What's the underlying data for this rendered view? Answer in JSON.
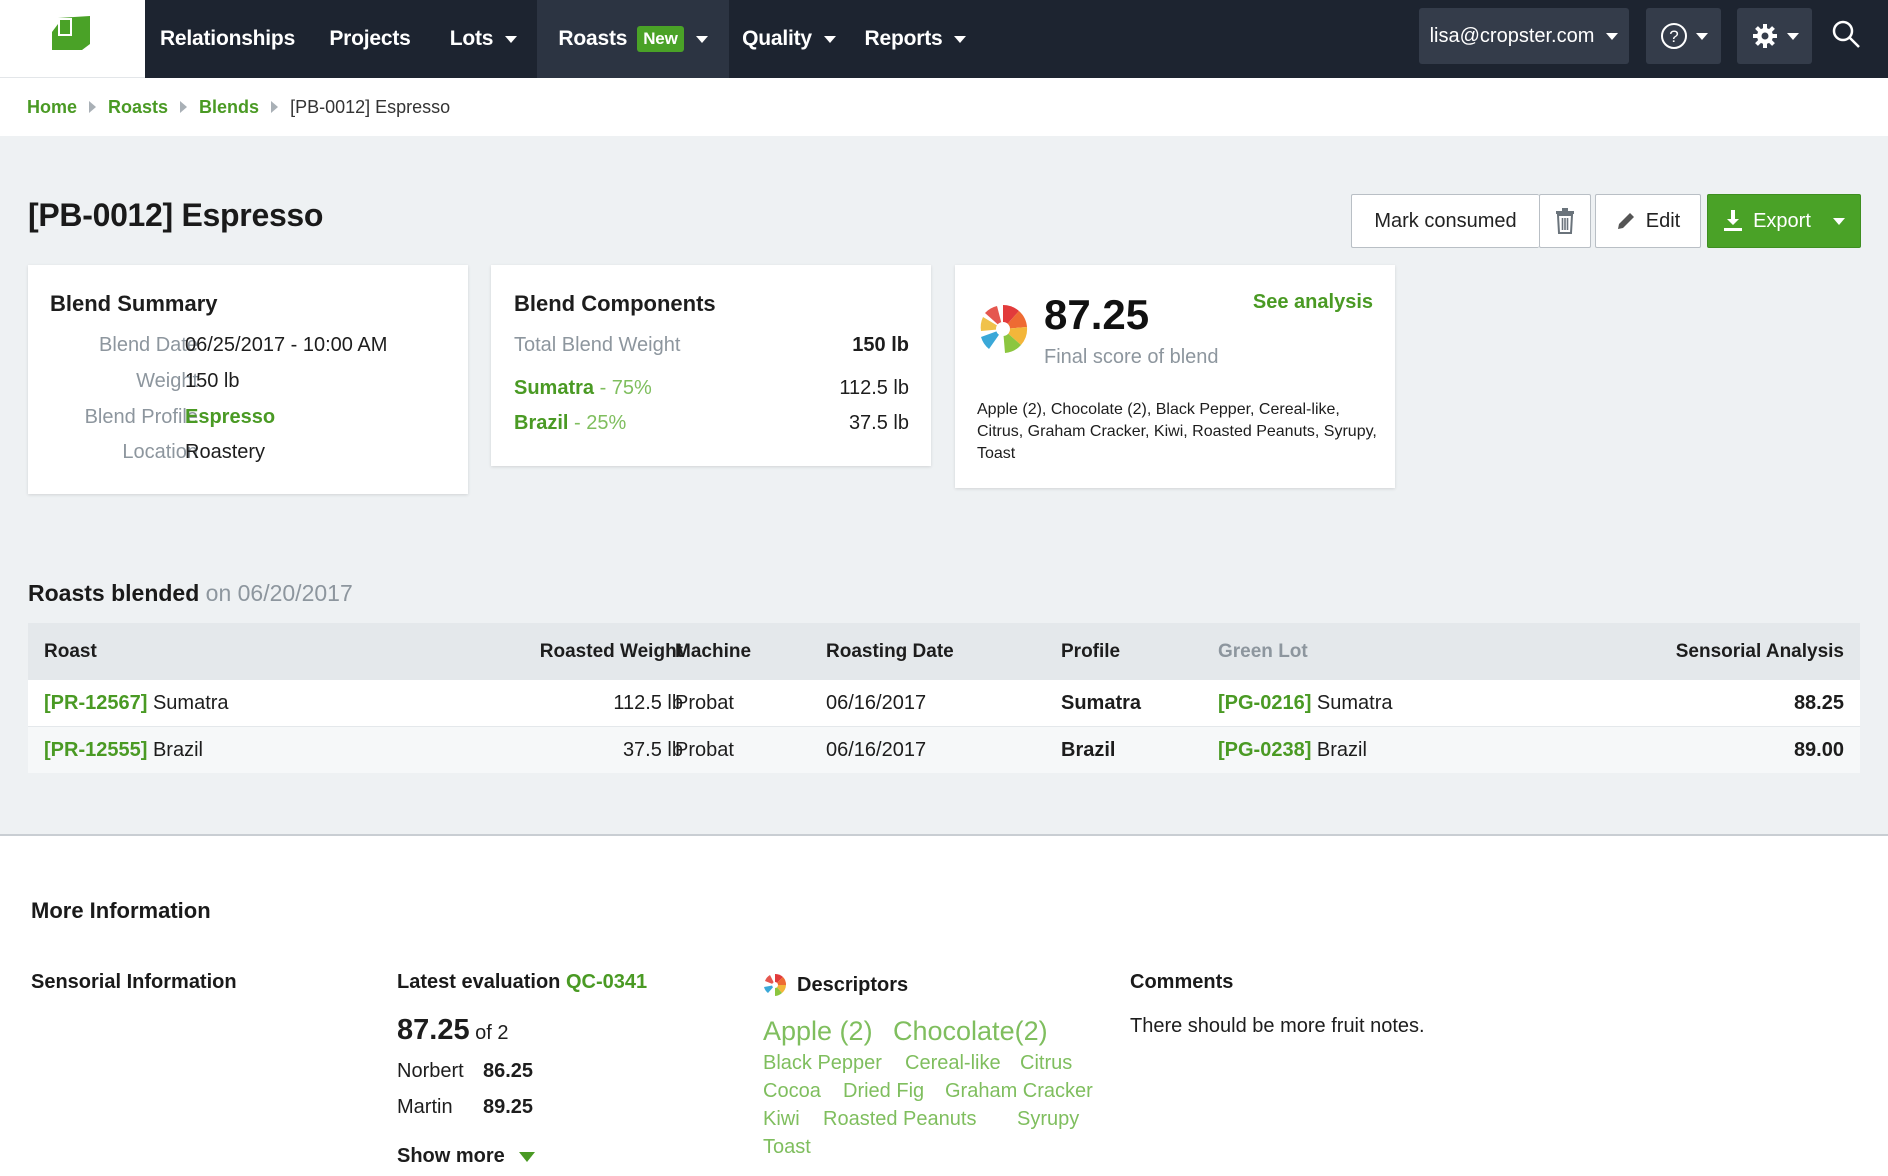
{
  "nav": {
    "items": [
      {
        "label": "Relationships"
      },
      {
        "label": "Projects"
      },
      {
        "label": "Lots"
      },
      {
        "label": "Roasts",
        "badge": "New"
      },
      {
        "label": "Quality"
      },
      {
        "label": "Reports"
      }
    ],
    "user": "lisa@cropster.com",
    "help_icon": "question-circle-icon",
    "settings_icon": "gear-icon",
    "search_icon": "search-icon",
    "brand_color": "#4aa227"
  },
  "breadcrumb": {
    "items": [
      "Home",
      "Roasts",
      "Blends"
    ],
    "current": "[PB-0012] Espresso"
  },
  "page": {
    "title": "[PB-0012] Espresso",
    "actions": {
      "mark_consumed": "Mark consumed",
      "delete_icon": "trash-icon",
      "edit": "Edit",
      "export": "Export"
    }
  },
  "blend_summary": {
    "title": "Blend Summary",
    "rows": [
      {
        "label": "Blend Date",
        "value": "06/25/2017 - 10:00 AM"
      },
      {
        "label": "Weight",
        "value": "150 lb"
      },
      {
        "label": "Blend Profile",
        "value": "Espresso"
      },
      {
        "label": "Location",
        "value": "Roastery"
      }
    ]
  },
  "blend_components": {
    "title": "Blend Components",
    "total_label": "Total Blend Weight",
    "total_value": "150 lb",
    "components": [
      {
        "name": "Sumatra",
        "pct": " - 75%",
        "weight": "112.5 lb"
      },
      {
        "name": "Brazil",
        "pct": " - 25%",
        "weight": "37.5 lb"
      }
    ]
  },
  "score_card": {
    "score": "87.25",
    "subtitle": "Final score of blend",
    "link": "See analysis",
    "descriptors": "Apple (2), Chocolate (2), Black Pepper, Cereal-like, Citrus, Graham Cracker, Kiwi, Roasted Peanuts, Syrupy, Toast"
  },
  "roasts": {
    "title": "Roasts blended",
    "date": "on 06/20/2017",
    "columns": [
      "Roast",
      "Roasted Weight",
      "Machine",
      "Roasting Date",
      "Profile",
      "Green Lot",
      "Sensorial Analysis"
    ],
    "rows": [
      {
        "roast_id": "[PR-12567]",
        "roast_name": " Sumatra",
        "weight": "112.5 lb",
        "machine": "Probat",
        "date": "06/16/2017",
        "profile": "Sumatra",
        "lot_id": "[PG-0216]",
        "lot_name": " Sumatra",
        "score": "88.25"
      },
      {
        "roast_id": "[PR-12555]",
        "roast_name": " Brazil",
        "weight": "37.5 lb",
        "machine": "Probat",
        "date": "06/16/2017",
        "profile": "Brazil",
        "lot_id": "[PG-0238]",
        "lot_name": " Brazil",
        "score": "89.00"
      }
    ]
  },
  "more": {
    "title": "More Information",
    "sensorial": "Sensorial Information",
    "latest_label": "Latest evaluation",
    "latest_id": "QC-0341",
    "score": "87.25",
    "of": "of 2",
    "evaluators": [
      {
        "name": "Norbert",
        "score": "86.25"
      },
      {
        "name": "Martin",
        "score": "89.25"
      }
    ],
    "show_more": "Show more",
    "descriptors_title": "Descriptors",
    "descriptors": [
      "Apple (2)",
      "Chocolate(2)",
      "Black Pepper",
      "Cereal-like",
      "Citrus",
      "Cocoa",
      "Dried Fig",
      "Graham Cracker",
      "Kiwi",
      "Roasted Peanuts",
      "Syrupy",
      "Toast"
    ],
    "comments_title": "Comments",
    "comments": "There should be more fruit notes."
  }
}
